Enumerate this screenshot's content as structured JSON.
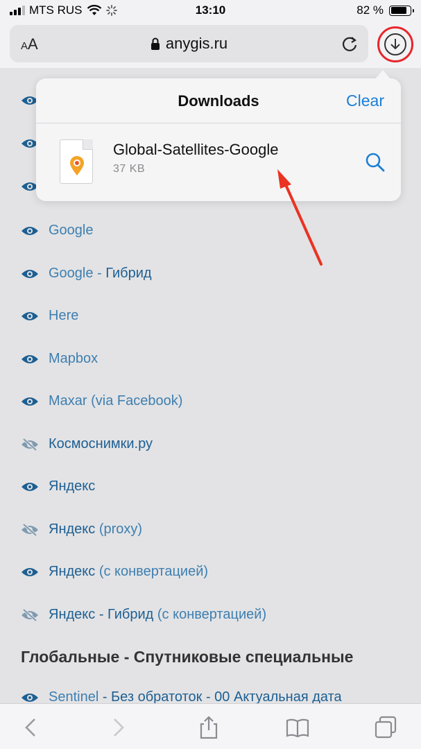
{
  "status": {
    "carrier": "MTS RUS",
    "time": "13:10",
    "battery": "82 %",
    "battery_level": 0.82
  },
  "toolbar": {
    "text_size_label_small": "A",
    "text_size_label_large": "A",
    "url": "anygis.ru"
  },
  "downloads": {
    "title": "Downloads",
    "clear_label": "Clear",
    "file_name": "Global-Satellites-Google",
    "file_size": "37 KB"
  },
  "list": [
    {
      "name": "Google",
      "suffix": "",
      "icon": "eye-icon"
    },
    {
      "name": "Google - ",
      "suffix": "Гибрид",
      "icon": "eye-icon"
    },
    {
      "name": "Here",
      "suffix": "",
      "icon": "eye-icon"
    },
    {
      "name": "Mapbox",
      "suffix": "",
      "icon": "eye-icon"
    },
    {
      "name": "Maxar (via Facebook)",
      "suffix": "",
      "icon": "eye-icon"
    },
    {
      "name": "Космоснимки.ру",
      "suffix": "",
      "icon": "eye-slash-icon"
    },
    {
      "name": "Яндекс",
      "suffix": "",
      "icon": "eye-icon"
    },
    {
      "name": "Яндекс ",
      "suffix": "(proxy)",
      "icon": "eye-slash-icon"
    },
    {
      "name": "Яндекс ",
      "suffix": "(с конвертацией)",
      "icon": "eye-icon"
    },
    {
      "name": "Яндекс - Гибрид ",
      "suffix": "(с конвертацией)",
      "icon": "eye-slash-icon"
    }
  ],
  "section_title": "Глобальные - Спутниковые специальные",
  "last_item": {
    "name": "Sentinel",
    "rest": " - Без обратоток - 00 Актуальная дата"
  },
  "colors": {
    "accent": "#1c7ed6",
    "link": "#3e7fb0",
    "highlight": "#e8262a"
  }
}
